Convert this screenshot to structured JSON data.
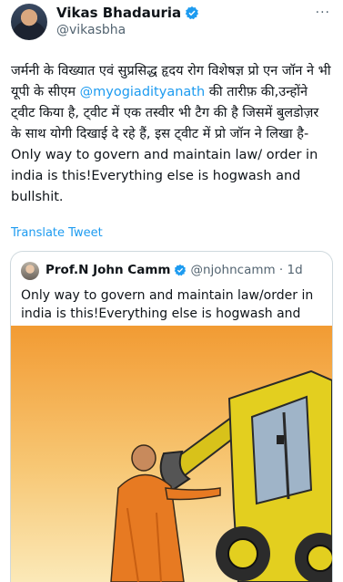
{
  "author": {
    "name": "Vikas Bhadauria",
    "handle": "@vikasbha"
  },
  "more_label": "···",
  "tweet": {
    "text_before": "जर्मनी के विख्यात एवं सुप्रसिद्ध हृदय रोग विशेषज्ञ प्रो एन जॉन ने भी यूपी के सीएम ",
    "mention": "@myogiadityanath",
    "text_after": " की तारीफ़ की,उन्होंने ट्वीट किया है, ट्वीट में एक तस्वीर भी टैग की है जिसमें बुलडोज़र के साथ योगी दिखाई दे रहे हैं, इस ट्वीट में प्रो जॉन ने लिखा है- Only way to govern and maintain law/ order in india is this!Everything else is hogwash and bullshit."
  },
  "translate_label": "Translate Tweet",
  "quoted": {
    "name": "Prof.N John Camm",
    "handle_time": "@njohncamm · 1d",
    "text": "Only way to govern and maintain law/order in india is this!Everything else is hogwash and bullshit."
  },
  "colors": {
    "link": "#1d9bf0",
    "verified": "#1d9bf0",
    "sky_top": "#f4a23a",
    "sky_bottom": "#fbe9b8",
    "bulldozer": "#e3cf1f",
    "robe": "#e77a22"
  }
}
